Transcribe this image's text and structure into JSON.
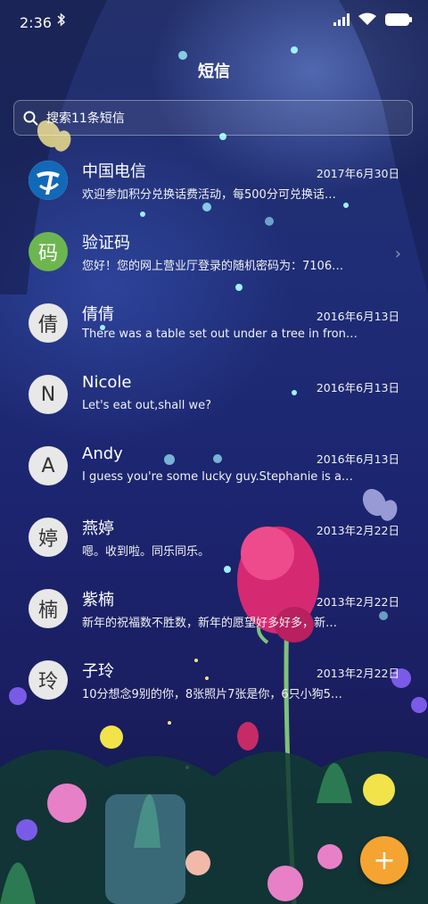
{
  "status_bar": {
    "time": "2:36",
    "bluetooth_icon": "bluetooth-icon",
    "signal_icon": "signal-icon",
    "wifi_icon": "wifi-icon",
    "battery_icon": "battery-icon"
  },
  "header": {
    "title": "短信"
  },
  "search": {
    "placeholder": "搜索11条短信",
    "icon": "search-icon"
  },
  "conversations": [
    {
      "avatar": "",
      "avatar_icon": "china-telecom-logo",
      "name": "中国电信",
      "date": "2017年6月30日",
      "snippet": "欢迎参加积分兑换话费活动，每500分可兑换话…"
    },
    {
      "avatar": "码",
      "name": "验证码",
      "date": "",
      "snippet": "您好！您的网上营业厅登录的随机密码为：7106…"
    },
    {
      "avatar": "倩",
      "name": "倩倩",
      "date": "2016年6月13日",
      "snippet": "There was a table set out under a tree in fron…"
    },
    {
      "avatar": "N",
      "name": "Nicole",
      "date": "2016年6月13日",
      "snippet": "Let's eat out,shall we?"
    },
    {
      "avatar": "A",
      "name": "Andy",
      "date": "2016年6月13日",
      "snippet": "I guess you're some lucky guy.Stephanie is a…"
    },
    {
      "avatar": "婷",
      "name": "燕婷",
      "date": "2013年2月22日",
      "snippet": "嗯。收到啦。同乐同乐。"
    },
    {
      "avatar": "楠",
      "name": "紫楠",
      "date": "2013年2月22日",
      "snippet": "新年的祝福数不胜数，新年的愿望好多好多，新…"
    },
    {
      "avatar": "玲",
      "name": "子玲",
      "date": "2013年2月22日",
      "snippet": "10分想念9别的你，8张照片7张是你，6只小狗5…"
    }
  ],
  "fab": {
    "label": "+",
    "icon": "add-icon"
  },
  "colors": {
    "accent": "#f5a431",
    "verify_avatar": "#6db64f",
    "background": "#1f2d76"
  }
}
